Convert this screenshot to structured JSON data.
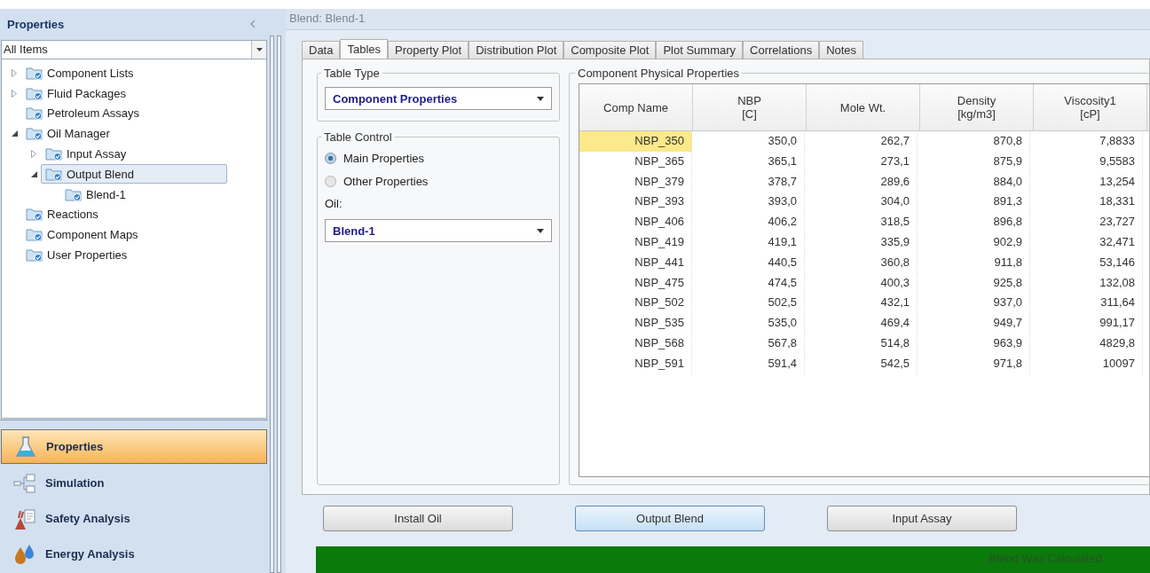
{
  "sidebar": {
    "title": "Properties",
    "filter": "All Items",
    "tree": [
      {
        "label": "Component Lists",
        "expanded": false
      },
      {
        "label": "Fluid Packages",
        "expanded": false
      },
      {
        "label": "Petroleum Assays"
      },
      {
        "label": "Oil Manager",
        "expanded": true,
        "children": [
          {
            "label": "Input Assay",
            "expanded": false
          },
          {
            "label": "Output Blend",
            "expanded": true,
            "selected": true,
            "children": [
              {
                "label": "Blend-1"
              }
            ]
          }
        ]
      },
      {
        "label": "Reactions"
      },
      {
        "label": "Component Maps"
      },
      {
        "label": "User Properties"
      }
    ],
    "nav": [
      {
        "label": "Properties",
        "kind": "flask",
        "selected": true
      },
      {
        "label": "Simulation",
        "kind": "diagram",
        "selected": false
      },
      {
        "label": "Safety Analysis",
        "kind": "safety",
        "selected": false
      },
      {
        "label": "Energy Analysis",
        "kind": "energy",
        "selected": false
      }
    ]
  },
  "window": {
    "title": "Blend: Blend-1"
  },
  "tabs": [
    {
      "label": "Data",
      "selected": false
    },
    {
      "label": "Tables",
      "selected": true
    },
    {
      "label": "Property Plot",
      "selected": false
    },
    {
      "label": "Distribution Plot",
      "selected": false
    },
    {
      "label": "Composite Plot",
      "selected": false
    },
    {
      "label": "Plot Summary",
      "selected": false
    },
    {
      "label": "Correlations",
      "selected": false
    },
    {
      "label": "Notes",
      "selected": false
    }
  ],
  "table_type": {
    "title": "Table Type",
    "value": "Component Properties"
  },
  "table_control": {
    "title": "Table Control",
    "options": [
      {
        "label": "Main Properties",
        "selected": true
      },
      {
        "label": "Other Properties",
        "selected": false
      }
    ],
    "oil_label": "Oil:",
    "oil_value": "Blend-1"
  },
  "properties": {
    "title": "Component Physical Properties",
    "columns": [
      {
        "label": "Comp Name"
      },
      {
        "label": "NBP",
        "unit": "[C]"
      },
      {
        "label": "Mole Wt."
      },
      {
        "label": "Density",
        "unit": "[kg/m3]"
      },
      {
        "label": "Viscosity1",
        "unit": "[cP]"
      }
    ],
    "rows": [
      {
        "cells": [
          "NBP_350",
          "350,0",
          "262,7",
          "870,8",
          "7,8833"
        ],
        "selected": true
      },
      {
        "cells": [
          "NBP_365",
          "365,1",
          "273,1",
          "875,9",
          "9,5583"
        ],
        "selected": false
      },
      {
        "cells": [
          "NBP_379",
          "378,7",
          "289,6",
          "884,0",
          "13,254"
        ],
        "selected": false
      },
      {
        "cells": [
          "NBP_393",
          "393,0",
          "304,0",
          "891,3",
          "18,331"
        ],
        "selected": false
      },
      {
        "cells": [
          "NBP_406",
          "406,2",
          "318,5",
          "896,8",
          "23,727"
        ],
        "selected": false
      },
      {
        "cells": [
          "NBP_419",
          "419,1",
          "335,9",
          "902,9",
          "32,471"
        ],
        "selected": false
      },
      {
        "cells": [
          "NBP_441",
          "440,5",
          "360,8",
          "911,8",
          "53,146"
        ],
        "selected": false
      },
      {
        "cells": [
          "NBP_475",
          "474,5",
          "400,3",
          "925,8",
          "132,08"
        ],
        "selected": false
      },
      {
        "cells": [
          "NBP_502",
          "502,5",
          "432,1",
          "937,0",
          "311,64"
        ],
        "selected": false
      },
      {
        "cells": [
          "NBP_535",
          "535,0",
          "469,4",
          "949,7",
          "991,17"
        ],
        "selected": false
      },
      {
        "cells": [
          "NBP_568",
          "567,8",
          "514,8",
          "963,9",
          "4829,8"
        ],
        "selected": false
      },
      {
        "cells": [
          "NBP_591",
          "591,4",
          "542,5",
          "971,8",
          "10097"
        ],
        "selected": false
      }
    ]
  },
  "buttons": [
    {
      "label": "Install Oil",
      "focused": false
    },
    {
      "label": "Output Blend",
      "focused": true
    },
    {
      "label": "Input Assay",
      "focused": false
    }
  ],
  "status_bar": {
    "text": "Blend Was Calculated"
  }
}
